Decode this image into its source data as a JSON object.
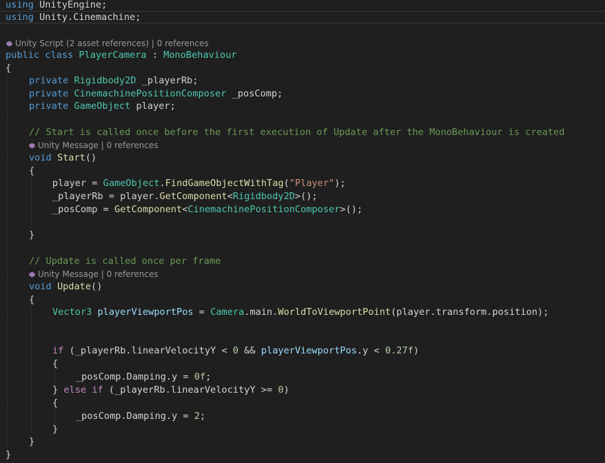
{
  "editor": {
    "language": "csharp",
    "theme_colors": {
      "background": "#1f1f1f",
      "keyword": "#569cd6",
      "control": "#c586c0",
      "type": "#4ec9b0",
      "variable": "#9cdcfe",
      "function": "#dcdcaa",
      "string": "#ce9178",
      "number": "#b5cea8",
      "comment": "#6a9955",
      "codelens": "#9a9a9a"
    },
    "lines": {
      "l1_kw": "using",
      "l1_rest": " UnityEngine;",
      "l2_kw": "using",
      "l2_rest": " Unity.Cinemachine;",
      "l4_public": "public",
      "l4_class": " class ",
      "l4_name": "PlayerCamera",
      "l4_colon": " : ",
      "l4_base": "MonoBehaviour",
      "l5": "{",
      "l6_kw": "private",
      "l6_type": "Rigidbody2D",
      "l6_name": " _playerRb;",
      "l7_kw": "private",
      "l7_type": "CinemachinePositionComposer",
      "l7_name": " _posComp;",
      "l8_kw": "private",
      "l8_type": "GameObject",
      "l8_name": " player;",
      "l10_comment": "// Start is called once before the first execution of Update after the MonoBehaviour is created",
      "l11_kw": "void",
      "l11_fn": "Start",
      "l11_rest": "()",
      "l12": "{",
      "l13_a": "player = ",
      "l13_type": "GameObject",
      "l13_b": ".",
      "l13_fn": "FindGameObjectWithTag",
      "l13_c": "(",
      "l13_str": "\"Player\"",
      "l13_d": ");",
      "l14_a": "_playerRb = player.",
      "l14_fn": "GetComponent",
      "l14_b": "<",
      "l14_type": "Rigidbody2D",
      "l14_c": ">();",
      "l15_a": "_posComp = ",
      "l15_fn": "GetComponent",
      "l15_b": "<",
      "l15_type": "CinemachinePositionComposer",
      "l15_c": ">();",
      "l17": "}",
      "l19_comment": "// Update is called once per frame",
      "l20_kw": "void",
      "l20_fn": "Update",
      "l20_rest": "()",
      "l21": "{",
      "l22_type": "Vector3",
      "l22_var": " playerViewportPos",
      "l22_a": " = ",
      "l22_type2": "Camera",
      "l22_b": ".main.",
      "l22_fn": "WorldToViewportPoint",
      "l22_c": "(player.transform.position);",
      "l25_if": "if",
      "l25_a": " (_playerRb.linearVelocityY < ",
      "l25_num": "0",
      "l25_b": " && ",
      "l25_var": "playerViewportPos",
      "l25_c": ".y < ",
      "l25_num2": "0.27f",
      "l25_d": ")",
      "l26": "{",
      "l27_a": "_posComp.Damping.y = ",
      "l27_num": "0f",
      "l27_b": ";",
      "l28_a": "} ",
      "l28_else": "else",
      "l28_sp": " ",
      "l28_if": "if",
      "l28_b": " (_playerRb.linearVelocityY >= ",
      "l28_num": "0",
      "l28_c": ")",
      "l29": "{",
      "l30_a": "_posComp.Damping.y = ",
      "l30_num": "2",
      "l30_b": ";",
      "l31": "}",
      "l32": "}",
      "l33": "}"
    },
    "codelens": {
      "class_lens": "Unity Script (2 asset references) | 0 references",
      "start_lens": "Unity Message | 0 references",
      "update_lens": "Unity Message | 0 references"
    }
  }
}
